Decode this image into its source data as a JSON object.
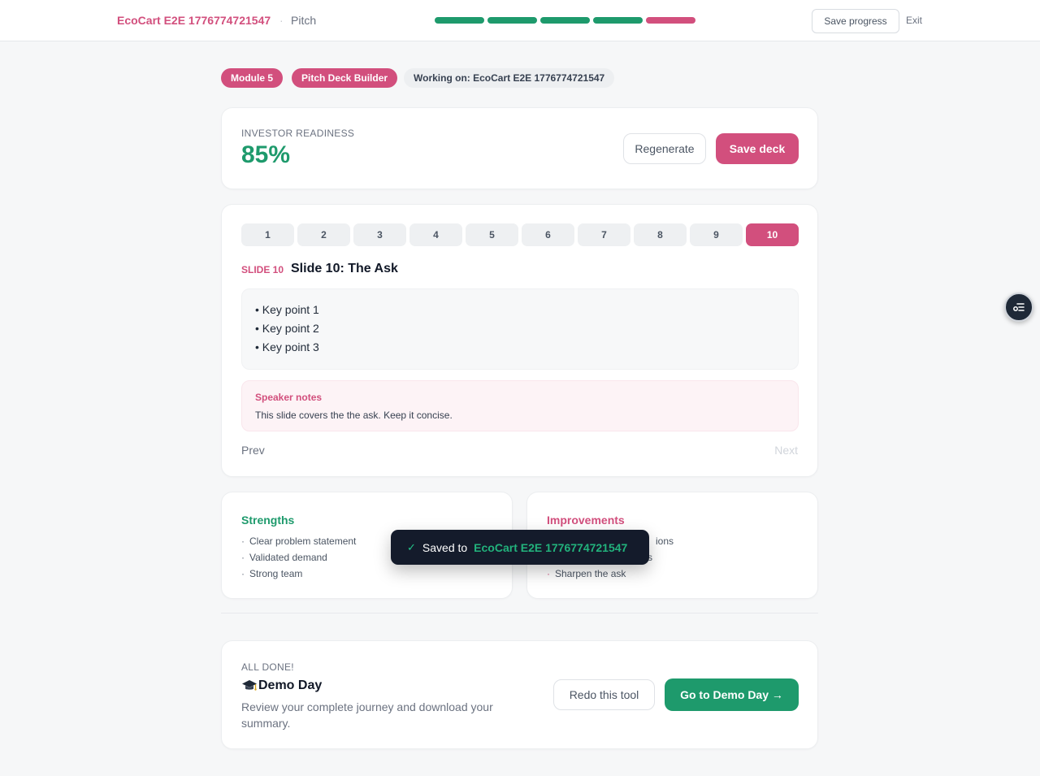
{
  "header": {
    "brand": "EcoCart E2E 1776774721547",
    "separator": "·",
    "crumb": "Pitch",
    "progress_colors": [
      "#1e9a6c",
      "#1e9a6c",
      "#1e9a6c",
      "#1e9a6c",
      "#d24f7d"
    ],
    "save_progress_label": "Save progress",
    "exit_label": "Exit"
  },
  "pills": {
    "module": "Module 5",
    "tool": "Pitch Deck Builder",
    "working_on": "Working on: EcoCart E2E 1776774721547"
  },
  "readiness": {
    "label": "INVESTOR READINESS",
    "value": "85%",
    "regenerate_label": "Regenerate",
    "save_deck_label": "Save deck"
  },
  "slides": {
    "tabs": [
      "1",
      "2",
      "3",
      "4",
      "5",
      "6",
      "7",
      "8",
      "9",
      "10"
    ],
    "active_index": 9,
    "slide_number_label": "SLIDE 10",
    "slide_title": "Slide 10: The Ask",
    "points": [
      "• Key point 1",
      "• Key point 2",
      "• Key point 3"
    ],
    "notes_label": "Speaker notes",
    "notes_text": "This slide covers the the ask. Keep it concise.",
    "prev_label": "Prev",
    "next_label": "Next"
  },
  "strengths": {
    "title": "Strengths",
    "bullet": "·",
    "items": [
      "Clear problem statement",
      "Validated demand",
      "Strong team"
    ]
  },
  "improvements": {
    "title": "Improvements",
    "bullet": "·",
    "items": [
      "ions",
      "s",
      "Sharpen the ask"
    ]
  },
  "toast": {
    "check": "✓",
    "prefix": "Saved to",
    "target": "EcoCart E2E 1776774721547"
  },
  "done": {
    "label": "ALL DONE!",
    "icon": "graduation-cap-icon",
    "title": "Demo Day",
    "description": "Review your complete journey and download your summary.",
    "redo_label": "Redo this tool",
    "go_label": "Go to Demo Day →"
  },
  "colors": {
    "accent_pink": "#d24f7d",
    "accent_green": "#1e9a6c",
    "toast_bg": "#141b2b"
  }
}
